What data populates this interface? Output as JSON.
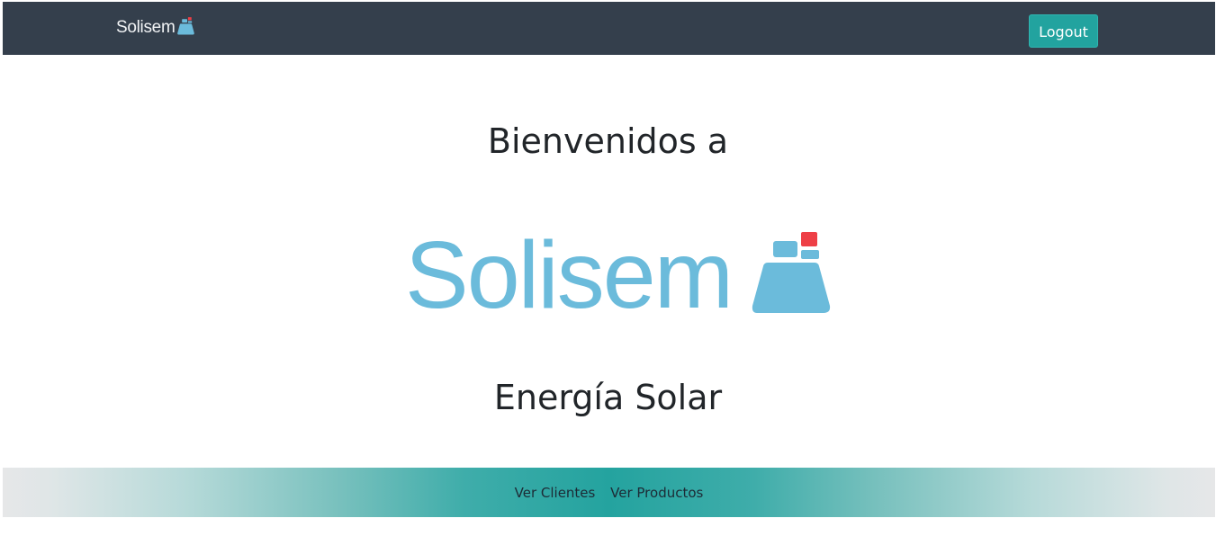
{
  "navbar": {
    "brand_text": "Solisem",
    "logout_label": "Logout",
    "background_color": "#343f4c",
    "logout_color": "#22a39f"
  },
  "main": {
    "welcome_text": "Bienvenidos a",
    "logo_text": "Solisem",
    "subtitle": "Energía Solar",
    "logo_color": "#6bbbdb",
    "logo_accent_color": "#ee3f46"
  },
  "footer": {
    "links": [
      {
        "label": "Ver Clientes"
      },
      {
        "label": "Ver Productos"
      }
    ],
    "accent_color": "#24a39f"
  },
  "icons": {
    "brand_logo": "solisem-logo-icon"
  }
}
